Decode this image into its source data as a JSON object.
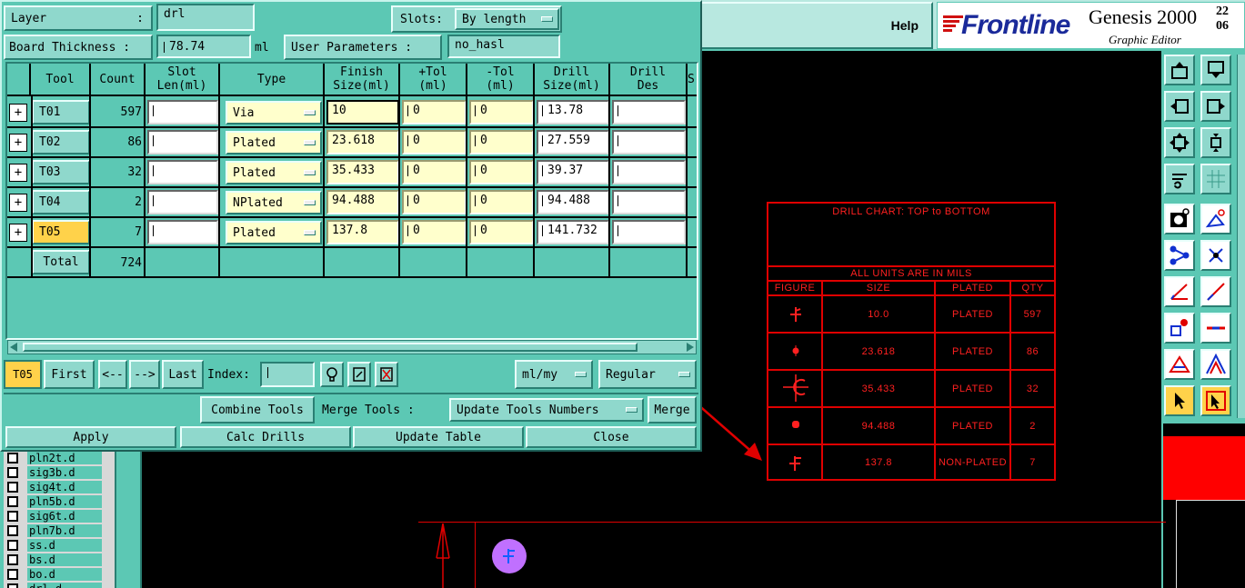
{
  "top": {
    "layer_label": "Layer",
    "layer_colon": ":",
    "layer_value": "drl",
    "slots_label": "Slots:",
    "slots_value": "By length",
    "thickness_label": "Board Thickness :",
    "thickness_value": "78.74",
    "thickness_unit": "ml",
    "user_params_label": "User Parameters :",
    "user_params_value": "no_hasl"
  },
  "table": {
    "headers": {
      "tool": "Tool",
      "count": "Count",
      "slot1": "Slot",
      "slot2": "Len(ml)",
      "type": "Type",
      "finish1": "Finish",
      "finish2": "Size(ml)",
      "ptol1": "+Tol",
      "ptol2": "(ml)",
      "mtol1": "-Tol",
      "mtol2": "(ml)",
      "drill1": "Drill",
      "drill2": "Size(ml)",
      "des1": "Drill",
      "des2": "Des",
      "s": "S"
    },
    "rows": [
      {
        "tool": "T01",
        "count": "597",
        "type": "Via",
        "finish": "10",
        "ptol": "0",
        "mtol": "0",
        "drill": "13.78"
      },
      {
        "tool": "T02",
        "count": "86",
        "type": "Plated",
        "finish": "23.618",
        "ptol": "0",
        "mtol": "0",
        "drill": "27.559"
      },
      {
        "tool": "T03",
        "count": "32",
        "type": "Plated",
        "finish": "35.433",
        "ptol": "0",
        "mtol": "0",
        "drill": "39.37"
      },
      {
        "tool": "T04",
        "count": "2",
        "type": "NPlated",
        "finish": "94.488",
        "ptol": "0",
        "mtol": "0",
        "drill": "94.488"
      },
      {
        "tool": "T05",
        "count": "7",
        "type": "Plated",
        "finish": "137.8",
        "ptol": "0",
        "mtol": "0",
        "drill": "141.732"
      }
    ],
    "total_label": "Total",
    "total_value": "724"
  },
  "nav": {
    "current": "T05",
    "first": "First",
    "prev": "<--",
    "next": "-->",
    "last": "Last",
    "index_label": "Index:",
    "units": "ml/my",
    "mode": "Regular"
  },
  "actions": {
    "combine": "Combine Tools",
    "merge_label": "Merge Tools :",
    "merge_option": "Update Tools Numbers",
    "merge": "Merge",
    "apply": "Apply",
    "calc": "Calc Drills",
    "update": "Update Table",
    "close": "Close"
  },
  "layers": [
    "pln2t.d",
    "sig3b.d",
    "sig4t.d",
    "pln5b.d",
    "sig6t.d",
    "pln7b.d",
    "ss.d",
    "bs.d",
    "bo.d",
    "drl.d"
  ],
  "header": {
    "help": "Help",
    "brand": "Frontline",
    "product": "Genesis 2000",
    "subtitle": "Graphic Editor",
    "corner1": "22",
    "corner2": "06"
  },
  "drill_chart": {
    "title": "DRILL CHART: TOP to BOTTOM",
    "units_note": "ALL UNITS ARE IN MILS",
    "columns": [
      "FIGURE",
      "SIZE",
      "PLATED",
      "QTY"
    ],
    "rows": [
      {
        "size": "10.0",
        "plated": "PLATED",
        "qty": "597"
      },
      {
        "size": "23.618",
        "plated": "PLATED",
        "qty": "86"
      },
      {
        "size": "35.433",
        "plated": "PLATED",
        "qty": "32"
      },
      {
        "size": "94.488",
        "plated": "PLATED",
        "qty": "2"
      },
      {
        "size": "137.8",
        "plated": "NON-PLATED",
        "qty": "7"
      }
    ]
  },
  "colors": {
    "panel": "#5cc8b4",
    "button": "#8fd8cc",
    "highlight": "#ffd24a",
    "cell": "#ffffcc",
    "chart": "#ff2020",
    "marker": "#c070ff"
  }
}
